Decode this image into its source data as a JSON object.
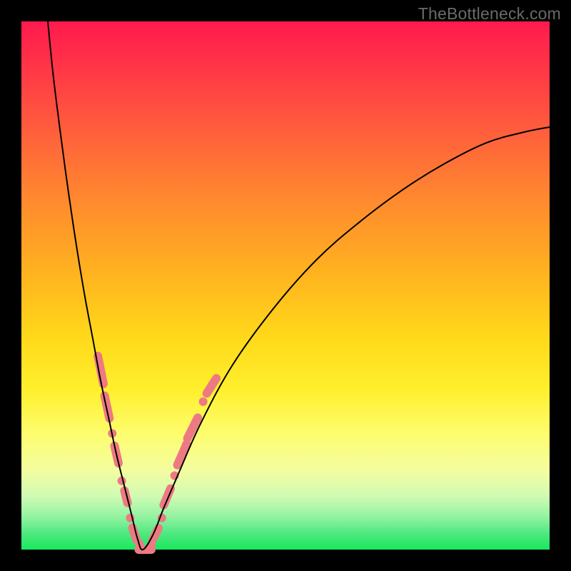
{
  "watermark": "TheBottleneck.com",
  "colors": {
    "frame": "#000000",
    "curve": "#000000",
    "marker": "#ed7a82",
    "gradient_top": "#ff1a4d",
    "gradient_bottom": "#18e85e"
  },
  "chart_data": {
    "type": "line",
    "title": "",
    "xlabel": "",
    "ylabel": "",
    "xlim": [
      0,
      100
    ],
    "ylim": [
      0,
      100
    ],
    "notes": "V-shaped bottleneck curve. Minimum (y≈0) occurs near x≈23. Left branch rises steeply to y≈100 at x≈5; right branch rises with decreasing slope to y≈80 at x≈100. Marker cluster (pink capsules/dots) lies along both branches roughly between y=0 and y=32. No axis ticks or numeric labels are rendered in the image; values below are visual estimates in percent-of-plot coordinates.",
    "series": [
      {
        "name": "left_branch",
        "x": [
          5.0,
          6.0,
          7.5,
          9.0,
          10.5,
          12.0,
          13.5,
          15.0,
          16.5,
          18.0,
          19.5,
          21.0,
          22.0,
          23.0
        ],
        "y": [
          100,
          90,
          78,
          67,
          57,
          48,
          40,
          32,
          25,
          18,
          12,
          6,
          2,
          0
        ]
      },
      {
        "name": "right_branch",
        "x": [
          23.0,
          25.0,
          27.0,
          30.0,
          34.0,
          40.0,
          48.0,
          56.0,
          64.0,
          72.0,
          80.0,
          88.0,
          95.0,
          100.0
        ],
        "y": [
          0,
          3,
          8,
          15,
          24,
          35,
          46,
          55,
          62,
          68,
          73,
          77,
          79,
          80
        ]
      }
    ],
    "markers": {
      "name": "highlighted_range",
      "description": "Pink rounded markers clustered along the lower portion of both branches (approx y ∈ [0,32]).",
      "points": [
        {
          "x": 15.0,
          "y": 34,
          "shape": "capsule",
          "len": 7
        },
        {
          "x": 16.2,
          "y": 27,
          "shape": "capsule",
          "len": 6
        },
        {
          "x": 17.2,
          "y": 22,
          "shape": "dot"
        },
        {
          "x": 18.0,
          "y": 18,
          "shape": "capsule",
          "len": 5
        },
        {
          "x": 19.0,
          "y": 13,
          "shape": "dot"
        },
        {
          "x": 19.8,
          "y": 10,
          "shape": "capsule",
          "len": 4
        },
        {
          "x": 20.6,
          "y": 6,
          "shape": "dot"
        },
        {
          "x": 21.4,
          "y": 3,
          "shape": "capsule",
          "len": 4
        },
        {
          "x": 22.4,
          "y": 1,
          "shape": "dot"
        },
        {
          "x": 23.4,
          "y": 0,
          "shape": "capsule",
          "len": 4,
          "orient": "h"
        },
        {
          "x": 24.6,
          "y": 1,
          "shape": "dot"
        },
        {
          "x": 25.4,
          "y": 3,
          "shape": "capsule",
          "len": 4
        },
        {
          "x": 26.6,
          "y": 6,
          "shape": "dot"
        },
        {
          "x": 27.6,
          "y": 10,
          "shape": "capsule",
          "len": 5
        },
        {
          "x": 29.0,
          "y": 14,
          "shape": "dot"
        },
        {
          "x": 30.4,
          "y": 18,
          "shape": "capsule",
          "len": 6
        },
        {
          "x": 32.4,
          "y": 23,
          "shape": "capsule",
          "len": 6
        },
        {
          "x": 34.4,
          "y": 28,
          "shape": "dot"
        },
        {
          "x": 36.0,
          "y": 31,
          "shape": "capsule",
          "len": 5
        }
      ]
    }
  }
}
